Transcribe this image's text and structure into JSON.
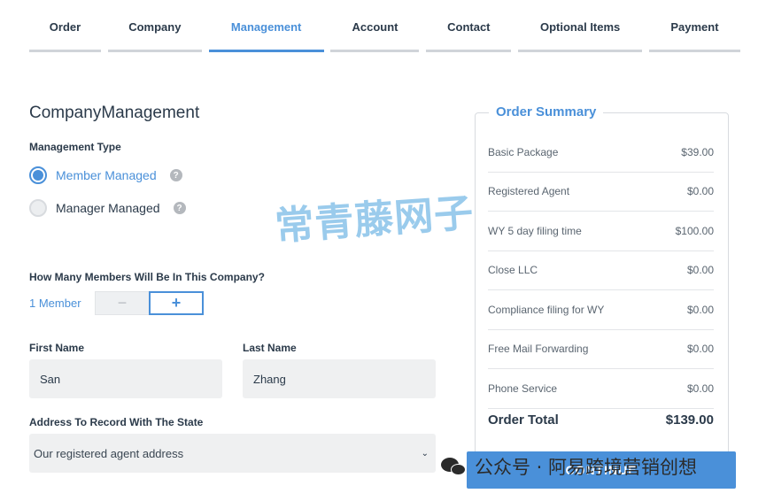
{
  "tabs": [
    {
      "label": "Order"
    },
    {
      "label": "Company"
    },
    {
      "label": "Management"
    },
    {
      "label": "Account"
    },
    {
      "label": "Contact"
    },
    {
      "label": "Optional Items"
    },
    {
      "label": "Payment"
    }
  ],
  "page_title": "CompanyManagement",
  "management_type": {
    "label": "Management Type",
    "options": [
      {
        "label": "Member Managed",
        "selected": true
      },
      {
        "label": "Manager Managed",
        "selected": false
      }
    ],
    "help_glyph": "?"
  },
  "members": {
    "question": "How Many Members Will Be In This Company?",
    "count_label": "1 Member",
    "minus": "−",
    "plus": "+"
  },
  "first_name": {
    "label": "First Name",
    "value": "San"
  },
  "last_name": {
    "label": "Last Name",
    "value": "Zhang"
  },
  "address": {
    "label": "Address To Record With The State",
    "value": "Our registered agent address",
    "chevron": "⌄"
  },
  "summary": {
    "title": "Order Summary",
    "items": [
      {
        "name": "Basic Package",
        "price": "$39.00"
      },
      {
        "name": "Registered Agent",
        "price": "$0.00"
      },
      {
        "name": "WY 5 day filing time",
        "price": "$100.00"
      },
      {
        "name": "Close LLC",
        "price": "$0.00"
      },
      {
        "name": "Compliance filing for WY",
        "price": "$0.00"
      },
      {
        "name": "Free Mail Forwarding",
        "price": "$0.00"
      },
      {
        "name": "Phone Service",
        "price": "$0.00"
      }
    ],
    "total_label": "Order Total",
    "total_value": "$139.00"
  },
  "continue_label": "CONTINUE",
  "watermark_main": "常青藤网子",
  "watermark_footer": "公众号 · 阿易跨境营销创想",
  "colors": {
    "accent": "#4a90d9",
    "text": "#2b3a4a",
    "field_bg": "#eff0f1"
  }
}
